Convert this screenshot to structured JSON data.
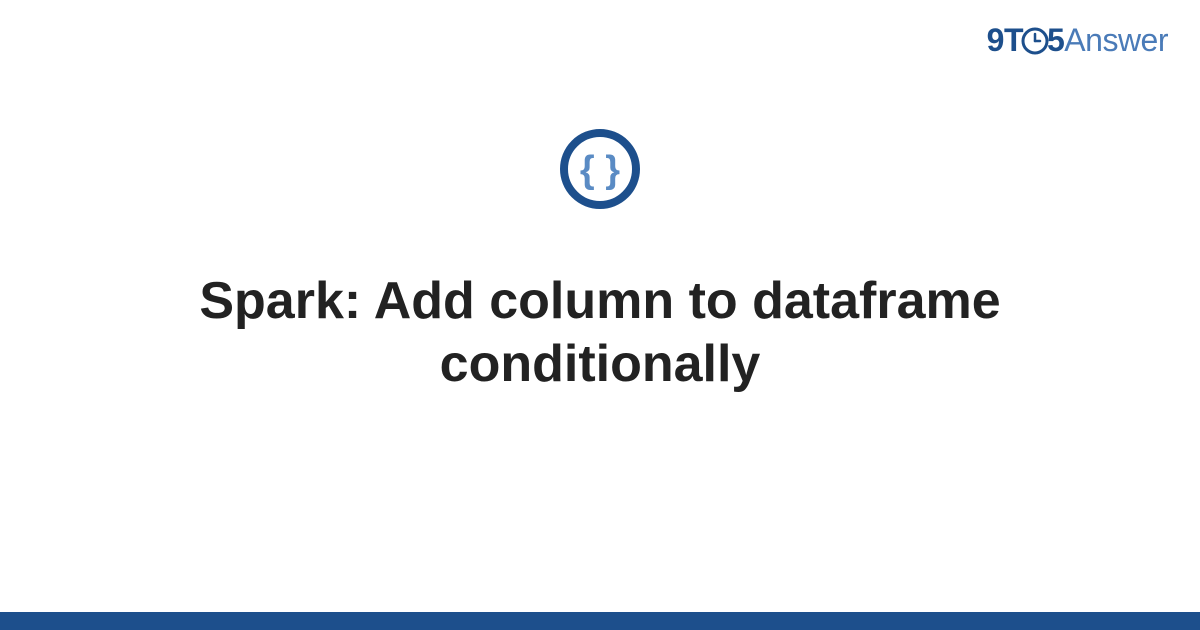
{
  "logo": {
    "part1": "9T",
    "part2": "5",
    "part3": "Answer"
  },
  "title": "Spark: Add column to dataframe conditionally",
  "colors": {
    "brand_dark": "#1d4f8c",
    "brand_light": "#4a7bb8",
    "icon_inner": "#5a8bc4"
  },
  "icon": {
    "name": "code-braces-icon"
  }
}
